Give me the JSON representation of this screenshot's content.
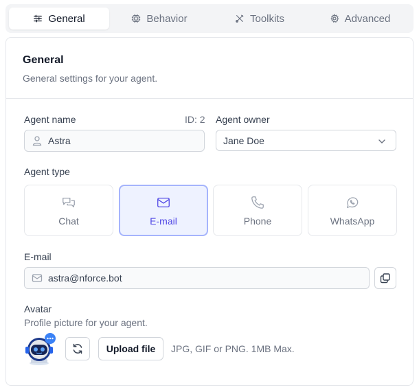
{
  "tabs": [
    {
      "label": "General",
      "icon": "sliders-icon",
      "active": true
    },
    {
      "label": "Behavior",
      "icon": "cpu-icon",
      "active": false
    },
    {
      "label": "Toolkits",
      "icon": "tools-icon",
      "active": false
    },
    {
      "label": "Advanced",
      "icon": "gear-icon",
      "active": false
    }
  ],
  "section": {
    "title": "General",
    "subtitle": "General settings for your agent."
  },
  "agent_name": {
    "label": "Agent name",
    "id_text": "ID: 2",
    "value": "Astra",
    "icon": "user-icon"
  },
  "agent_owner": {
    "label": "Agent owner",
    "value": "Jane Doe",
    "icon": "chevron-down-icon"
  },
  "agent_type": {
    "label": "Agent type",
    "options": [
      {
        "label": "Chat",
        "icon": "chat-icon",
        "selected": false
      },
      {
        "label": "E-mail",
        "icon": "mail-icon",
        "selected": true
      },
      {
        "label": "Phone",
        "icon": "phone-icon",
        "selected": false
      },
      {
        "label": "WhatsApp",
        "icon": "whatsapp-icon",
        "selected": false
      }
    ]
  },
  "email": {
    "label": "E-mail",
    "value": "astra@nforce.bot",
    "icon": "mail-icon",
    "copy_icon": "copy-icon"
  },
  "avatar": {
    "label": "Avatar",
    "description": "Profile picture for your agent.",
    "upload_label": "Upload file",
    "hint": "JPG, GIF or PNG. 1MB Max.",
    "refresh_icon": "refresh-icon"
  },
  "colors": {
    "accent": "#4f46e5",
    "accent_border": "#a5b4fc",
    "accent_bg": "#eef2ff"
  }
}
